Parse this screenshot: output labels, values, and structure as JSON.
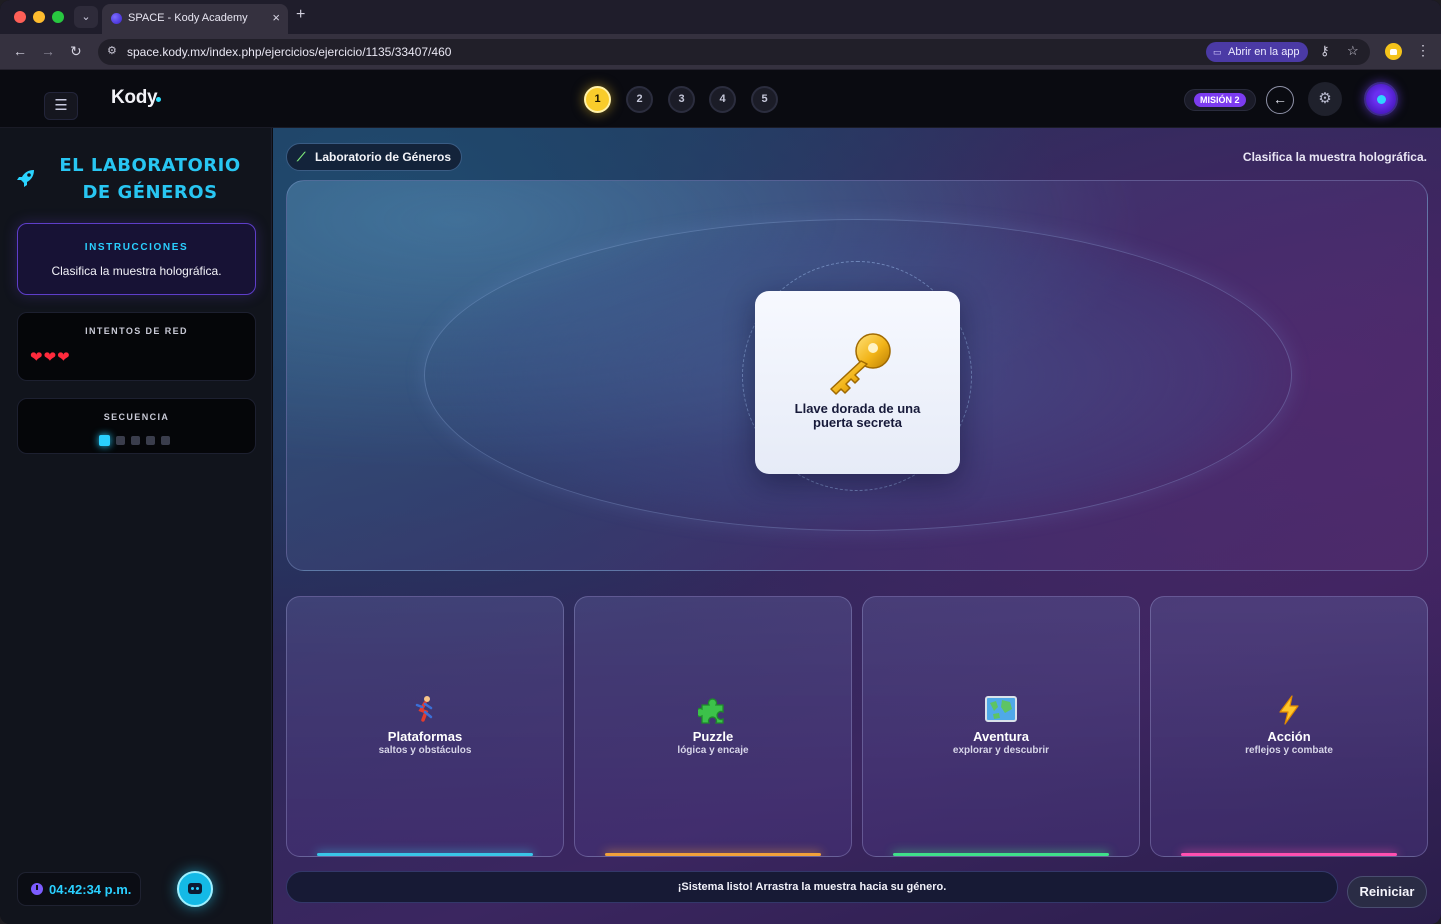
{
  "browser": {
    "tab_title": "SPACE - Kody Academy",
    "tab_close": "×",
    "new_tab": "+",
    "dropdown": "⌄",
    "url": "space.kody.mx/index.php/ejercicios/ejercicio/1135/33407/460",
    "open_app": "Abrir en la app",
    "back": "←",
    "forward": "→",
    "reload": "↻",
    "menu": "⋮"
  },
  "header": {
    "logo": "Kody",
    "menu_icon": "☰",
    "steps": [
      "1",
      "2",
      "3",
      "4",
      "5"
    ],
    "active_step": 1,
    "mission": "MISIÓN 2",
    "back_icon": "←",
    "gear_icon": "⚙"
  },
  "sidebar": {
    "title_line1": "EL LABORATORIO",
    "title_line2": "DE GÉNEROS",
    "instructions_label": "INSTRUCCIONES",
    "instructions_text": "Clasifica la muestra holográfica.",
    "attempts_label": "INTENTOS DE RED",
    "hearts": "❤❤❤",
    "lives": 3,
    "sequence_label": "SECUENCIA",
    "sequence_total": 5,
    "sequence_current": 1,
    "clock": "04:42:34 p.m."
  },
  "main": {
    "lab_label": "Laboratorio de Géneros",
    "top_hint": "Clasifica la muestra holográfica.",
    "sample_label": "Llave dorada de una puerta secreta",
    "genres": [
      {
        "name": "Plataformas",
        "desc": "saltos y obstáculos",
        "icon": "runner-icon",
        "glow": "#39c6e8"
      },
      {
        "name": "Puzzle",
        "desc": "lógica y encaje",
        "icon": "puzzle-icon",
        "glow": "#f2a13a"
      },
      {
        "name": "Aventura",
        "desc": "explorar y descubrir",
        "icon": "map-icon",
        "glow": "#3fe08a"
      },
      {
        "name": "Acción",
        "desc": "reflejos y combate",
        "icon": "lightning-icon",
        "glow": "#ff4fb0"
      }
    ],
    "status": "¡Sistema listo! Arrastra la muestra hacia su género.",
    "reset": "Reiniciar"
  }
}
